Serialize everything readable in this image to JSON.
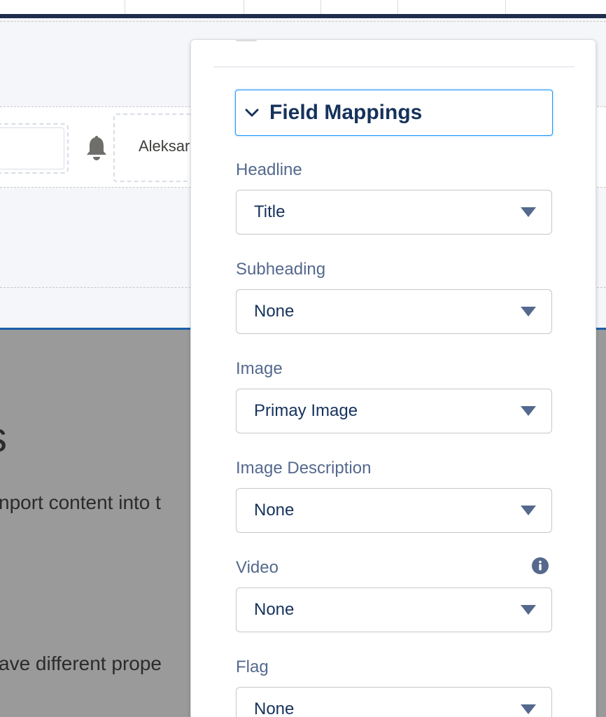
{
  "header": {
    "user_name": "Aleksar"
  },
  "background_text": {
    "big_char": "s",
    "line1": "nport content into t",
    "line2": "ave different prope"
  },
  "panel": {
    "section_title": "Field Mappings",
    "fields": [
      {
        "label": "Headline",
        "value": "Title"
      },
      {
        "label": "Subheading",
        "value": "None"
      },
      {
        "label": "Image",
        "value": "Primay Image"
      },
      {
        "label": "Image Description",
        "value": "None"
      },
      {
        "label": "Video",
        "value": "None"
      },
      {
        "label": "Flag",
        "value": "None"
      }
    ]
  },
  "icons": {
    "chevron": "chevron-down-icon",
    "bell": "bell-icon",
    "info": "info-icon",
    "dropdown": "caret-down-icon"
  },
  "colors": {
    "accent": "#1b96ff",
    "text_primary": "#16325c",
    "label": "#54698d",
    "overlay": "#9a9a9a"
  }
}
